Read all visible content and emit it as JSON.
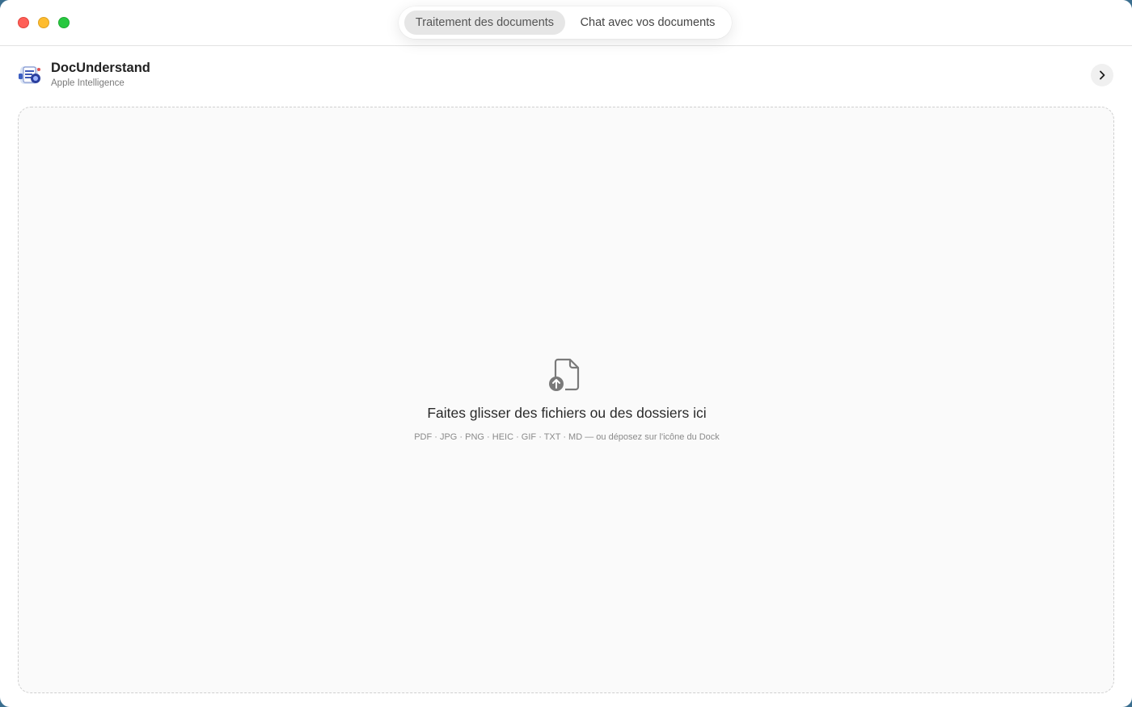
{
  "window": {
    "tabs": [
      {
        "label": "Traitement des documents",
        "active": true
      },
      {
        "label": "Chat avec vos documents",
        "active": false
      }
    ]
  },
  "header": {
    "app_name": "DocUnderstand",
    "subtitle": "Apple Intelligence",
    "expand_icon": "chevron-right-icon"
  },
  "dropzone": {
    "icon": "document-upload-icon",
    "title": "Faites glisser des fichiers ou des dossiers ici",
    "formats": "PDF · JPG · PNG · HEIC · GIF · TXT · MD — ou déposez sur l'icône du Dock"
  },
  "colors": {
    "close": "#ff5f57",
    "minimize": "#febc2e",
    "zoom": "#28c840",
    "active_tab_bg": "#e6e6e6",
    "dropzone_border": "#cfcfcf",
    "dropzone_bg": "#fafafa"
  }
}
